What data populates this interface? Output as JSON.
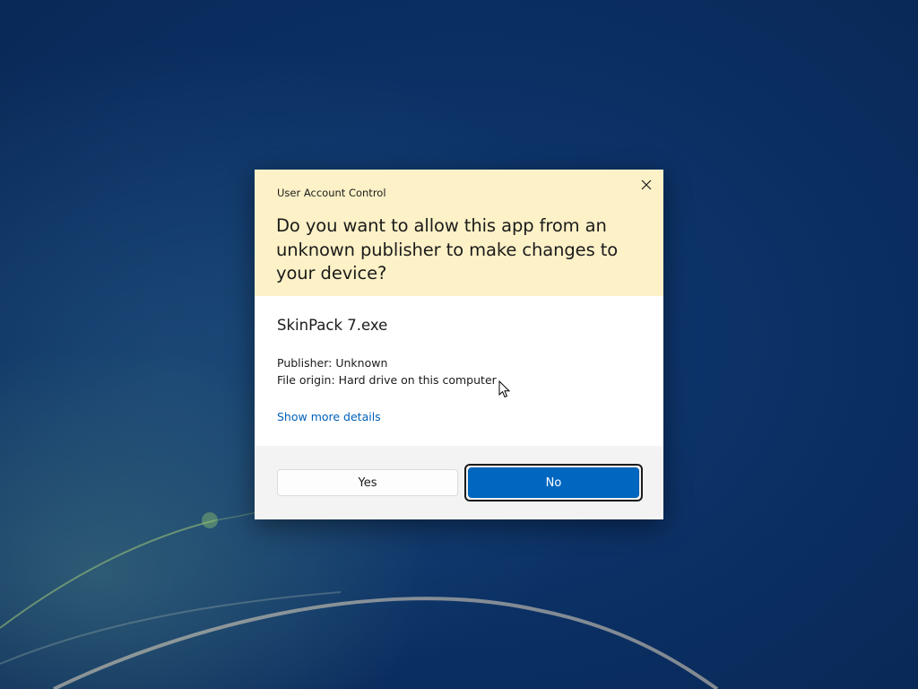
{
  "dialog": {
    "title": "User Account Control",
    "question": "Do you want to allow this app from an unknown publisher to make changes to your device?",
    "app_name": "SkinPack 7.exe",
    "publisher": "Publisher: Unknown",
    "file_origin": "File origin: Hard drive on this computer",
    "show_more_link": "Show more details",
    "yes_label": "Yes",
    "no_label": "No",
    "close_icon": "close-icon"
  },
  "colors": {
    "header_background": "#fdf1c7",
    "primary_button": "#0067c0",
    "link": "#005fb8",
    "footer_background": "#f3f3f3"
  }
}
